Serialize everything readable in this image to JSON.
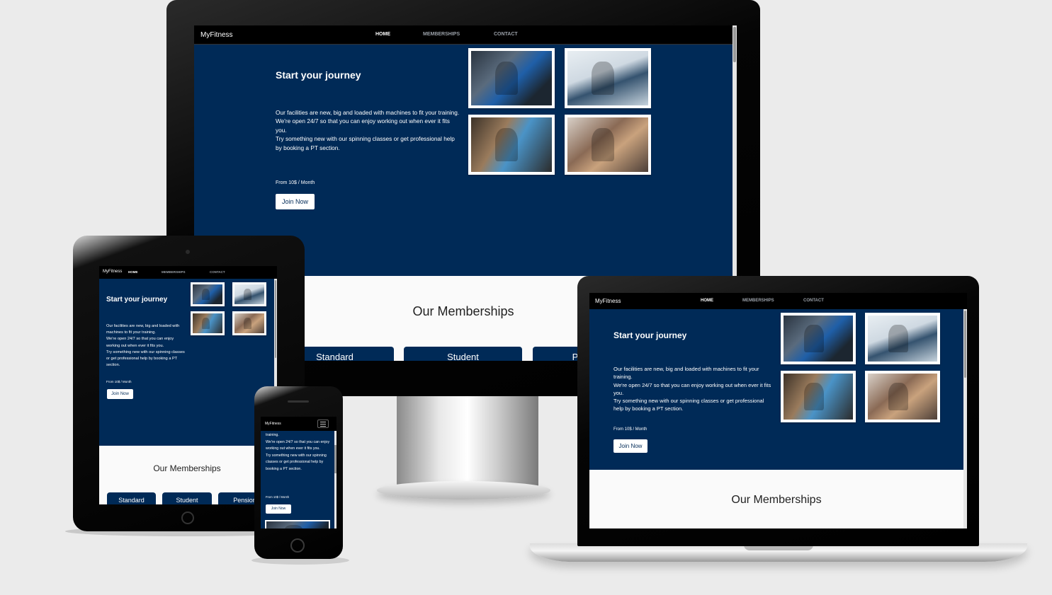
{
  "site": {
    "brand": "MyFitness",
    "nav": {
      "home": "HOME",
      "memberships": "MEMBERSHIPS",
      "contact": "CONTACT"
    },
    "hero": {
      "title": "Start your journey",
      "para1": "Our facilities are new, big and loaded with machines to fit your training.",
      "para2": "We're open 24/7 so that you can enjoy working out when ever it fits you.",
      "para3": "Try something new with our spinning classes or get professional help by booking a PT section.",
      "price": "From 10$ / Month",
      "join": "Join Now"
    },
    "memberships": {
      "title": "Our Memberships",
      "tabs": [
        "Standard",
        "Student",
        "Pensioner"
      ],
      "desktop_third_tab": "P",
      "tablet_third_tab": "Pensione"
    },
    "phone_text": {
      "line1": "training.",
      "para2": "We're open 24/7 so that you can enjoy working out when ever it fits you.",
      "para3": "Try something new with our spinning classes or get professional help by booking a PT section."
    }
  },
  "icons": [
    "hamburger-menu-icon",
    "gym-photo-1",
    "gym-photo-2",
    "gym-photo-3",
    "gym-photo-4"
  ],
  "colors": {
    "navy": "#002a57",
    "background": "#ebebeb",
    "bezel": "#000000"
  }
}
